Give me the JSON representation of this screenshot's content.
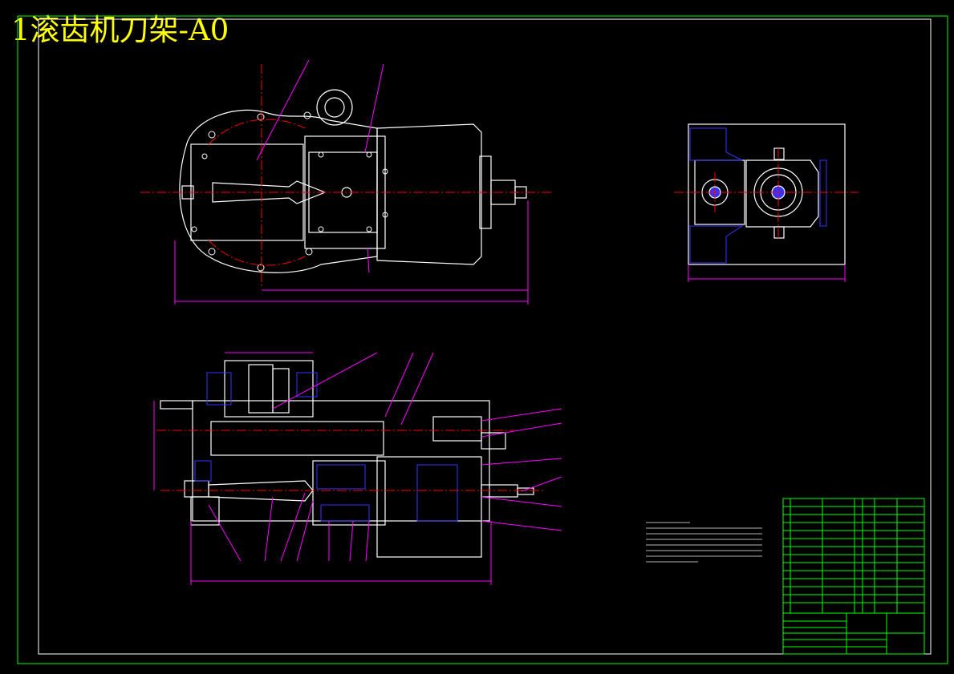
{
  "title": "1滚齿机刀架-A0",
  "colors": {
    "background": "#000000",
    "frame": "#00ff00",
    "outline": "#ffffff",
    "dimension": "#ff00ff",
    "centerline": "#ff0000",
    "hatch": "#3333ff",
    "title_text": "#ffff00"
  }
}
